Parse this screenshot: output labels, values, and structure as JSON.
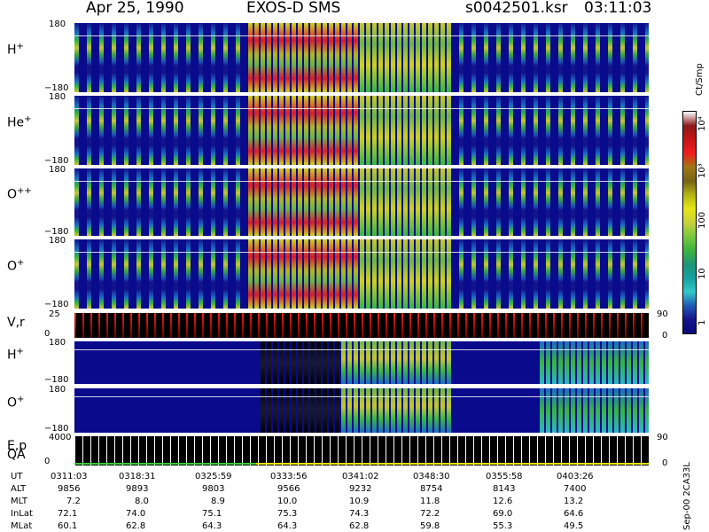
{
  "header": {
    "date": "Apr 25, 1990",
    "instrument": "EXOS-D SMS",
    "file": "s0042501.ksr",
    "time": "03:11:03"
  },
  "panels": [
    {
      "id": "hplus",
      "label": "H",
      "sup": "+",
      "ymax": "180",
      "ymin": "−180"
    },
    {
      "id": "heplus",
      "label": "He",
      "sup": "+",
      "ymax": "180",
      "ymin": "−180"
    },
    {
      "id": "oplusplus",
      "label": "O",
      "sup": "++",
      "ymax": "180",
      "ymin": "−180"
    },
    {
      "id": "oplus",
      "label": "O",
      "sup": "+",
      "ymax": "180",
      "ymin": "−180"
    },
    {
      "id": "vr",
      "label": "V,r",
      "ymax": "25",
      "ymin": "0",
      "rtop": "90",
      "rbot": "0"
    },
    {
      "id": "hplus2",
      "label": "H",
      "sup": "+",
      "ymax": "180",
      "ymin": "−180"
    },
    {
      "id": "oplus2",
      "label": "O",
      "sup": "+",
      "ymax": "180",
      "ymin": "−180"
    },
    {
      "id": "ep",
      "label": "E,p",
      "label2": "QA",
      "ymax": "4000",
      "ymin": "0",
      "rtop": "90",
      "rbot": "0"
    }
  ],
  "colorbar": {
    "title": "Ct/Smp",
    "ticks": [
      "10⁴",
      "10³",
      "100",
      "10",
      "1"
    ],
    "colors": [
      "#ffffff",
      "#8c1a1a",
      "#c81414",
      "#f01e1e",
      "#a07814",
      "#786414",
      "#b4b414",
      "#e6e614",
      "#c8d23c",
      "#78c83c",
      "#3cb43c",
      "#1e9678",
      "#14a0a0",
      "#32c8c8",
      "#1e5ab4",
      "#14148c",
      "#0a0a7a"
    ]
  },
  "footer_note": "Sep-00 2CA33L",
  "chart_data": {
    "type": "heatmap",
    "title": "Apr 25, 1990  EXOS-D SMS",
    "xlabel": "UT",
    "rows": [
      "UT",
      "ALT",
      "MLT",
      "InLat",
      "MLat"
    ],
    "table": [
      [
        "0311:03",
        "9856",
        "7.2",
        "72.1",
        "60.1"
      ],
      [
        "0318:31",
        "9893",
        "8.0",
        "74.0",
        "62.8"
      ],
      [
        "0325:59",
        "9803",
        "8.9",
        "75.1",
        "64.3"
      ],
      [
        "0333:56",
        "9566",
        "10.0",
        "75.3",
        "64.3"
      ],
      [
        "0341:02",
        "9232",
        "10.9",
        "74.3",
        "62.8"
      ],
      [
        "0348:30",
        "8754",
        "11.8",
        "72.2",
        "59.8"
      ],
      [
        "0355:58",
        "8143",
        "12.6",
        "69.0",
        "55.3"
      ],
      [
        "0403:26",
        "7400",
        "13.2",
        "64.6",
        "49.5"
      ]
    ],
    "colorbar_label": "Ct/Smp",
    "colorbar_ticks": [
      "1",
      "10",
      "100",
      "10³",
      "10⁴"
    ]
  }
}
